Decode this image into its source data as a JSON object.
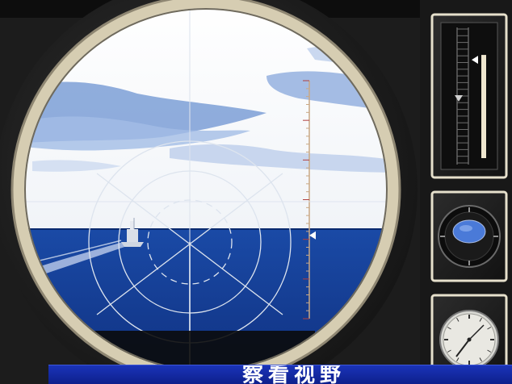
{
  "caption": "察看视野",
  "scope": {
    "range_level": 0.35,
    "depth_level": 0.82
  },
  "colors": {
    "sky": "#f6f8fb",
    "cloud": "#7fa2d8",
    "sea": "#143c96",
    "ring": "#d8cfb6",
    "reticle": "#dde4ee",
    "panel_frame": "#e6e0cc",
    "caption_bg": "#1428a0"
  },
  "icons": {
    "target_ship": "warship-icon",
    "periscope_indicator": "periscope-height-gauge-icon",
    "compass": "compass-gauge-icon",
    "clock": "clock-gauge-icon",
    "range_marker": "triangle-marker-icon"
  }
}
